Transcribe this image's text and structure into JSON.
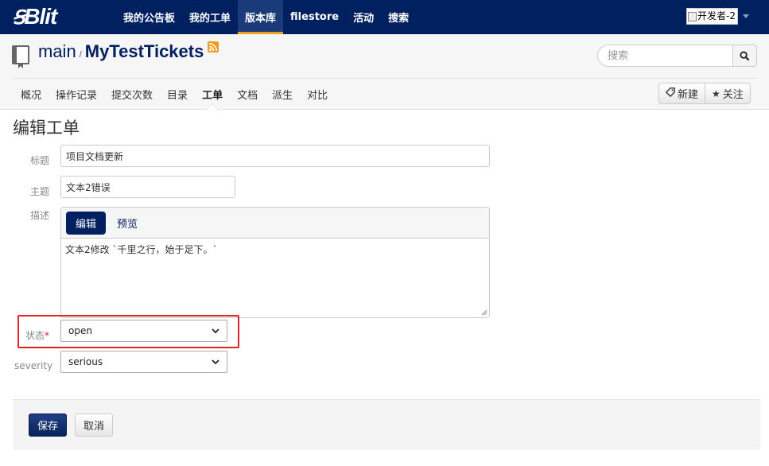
{
  "app": {
    "logo_mark": "Ꞩ",
    "logo_word": "Blit"
  },
  "topnav": {
    "items": [
      {
        "label": "我的公告板",
        "active": false
      },
      {
        "label": "我的工单",
        "active": false
      },
      {
        "label": "版本库",
        "active": true
      },
      {
        "label": "filestore",
        "active": false
      },
      {
        "label": "活动",
        "active": false
      },
      {
        "label": "搜索",
        "active": false
      }
    ],
    "user_alt": "开发者-2"
  },
  "repo": {
    "project": "main",
    "separator": "/",
    "name": "MyTestTickets",
    "search_placeholder": "搜索",
    "tabs": [
      "概况",
      "操作记录",
      "提交次数",
      "目录",
      "工单",
      "文档",
      "派生",
      "对比"
    ],
    "active_tab": "工单",
    "new_label": "新建",
    "watch_label": "关注"
  },
  "form": {
    "page_title": "编辑工单",
    "title_label": "标题",
    "title_value": "项目文档更新",
    "topic_label": "主题",
    "topic_value": "文本2错误",
    "desc_label": "描述",
    "edit_tab": "编辑",
    "preview_tab": "预览",
    "desc_value": "文本2修改 `千里之行，始于足下。`",
    "status_label": "状态",
    "status_required": "*",
    "status_value": "open",
    "severity_label": "severity",
    "severity_value": "serious",
    "save_label": "保存",
    "cancel_label": "取消"
  },
  "colors": {
    "navbar": "#002060",
    "accent": "#f0a020",
    "highlight": "#e0242c",
    "rss": "#f39a1e"
  }
}
